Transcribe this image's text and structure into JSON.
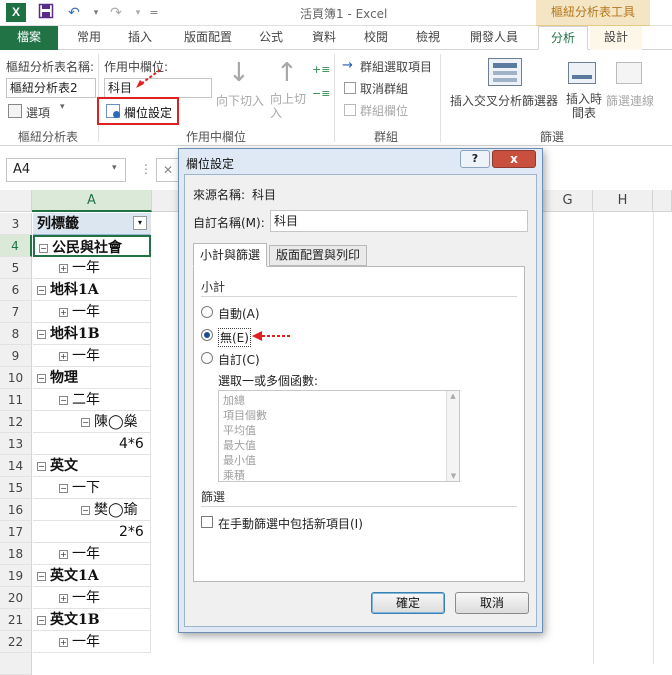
{
  "titlebar": {
    "app_icon_letter": "X",
    "window_title": "活頁簿1 - Excel",
    "context_tool_title": "樞紐分析表工具"
  },
  "tabs": [
    "檔案",
    "常用",
    "插入",
    "版面配置",
    "公式",
    "資料",
    "校閱",
    "檢視",
    "開發人員",
    "分析",
    "設計"
  ],
  "ribbon": {
    "pivot_name_label": "樞紐分析表名稱:",
    "pivot_name_value": "樞紐分析表2",
    "options_label": "選項",
    "group_pivot": "樞紐分析表",
    "active_field_label": "作用中欄位:",
    "active_field_value": "科目",
    "field_settings_label": "欄位設定",
    "drill_down_label": "向下切入",
    "drill_up_label": "向上切入",
    "group_active_field": "作用中欄位",
    "group_selection": "群組選取項目",
    "ungroup": "取消群組",
    "group_field": "群組欄位",
    "group_group": "群組",
    "insert_slicer": "插入交叉分析篩選器",
    "insert_timeline": "插入時間表",
    "filter_connections": "篩選連線",
    "group_filter": "篩選"
  },
  "namebox": {
    "value": "A4"
  },
  "columns": [
    "A",
    "G",
    "H"
  ],
  "rows": [
    {
      "num": "3",
      "text": "列標籤",
      "style": "header"
    },
    {
      "num": "4",
      "text": "公民與社會",
      "style": "bold",
      "expander": "minus",
      "indent": 0
    },
    {
      "num": "5",
      "text": "一年",
      "style": "normal",
      "expander": "plus",
      "indent": 1
    },
    {
      "num": "6",
      "text": "地科1A",
      "style": "bold",
      "expander": "minus",
      "indent": 0
    },
    {
      "num": "7",
      "text": "一年",
      "style": "normal",
      "expander": "plus",
      "indent": 1
    },
    {
      "num": "8",
      "text": "地科1B",
      "style": "bold",
      "expander": "minus",
      "indent": 0
    },
    {
      "num": "9",
      "text": "一年",
      "style": "normal",
      "expander": "plus",
      "indent": 1
    },
    {
      "num": "10",
      "text": "物理",
      "style": "bold",
      "expander": "minus",
      "indent": 0
    },
    {
      "num": "11",
      "text": "二年",
      "style": "normal",
      "expander": "minus",
      "indent": 1
    },
    {
      "num": "12",
      "text": "陳◯燊",
      "style": "normal",
      "expander": "minus",
      "indent": 2
    },
    {
      "num": "13",
      "text": "4*6",
      "style": "normal",
      "expander": "",
      "indent": 3
    },
    {
      "num": "14",
      "text": "英文",
      "style": "bold",
      "expander": "minus",
      "indent": 0
    },
    {
      "num": "15",
      "text": "一下",
      "style": "normal",
      "expander": "minus",
      "indent": 1
    },
    {
      "num": "16",
      "text": "樊◯瑜",
      "style": "normal",
      "expander": "minus",
      "indent": 2
    },
    {
      "num": "17",
      "text": "2*6",
      "style": "normal",
      "expander": "",
      "indent": 3
    },
    {
      "num": "18",
      "text": "一年",
      "style": "normal",
      "expander": "plus",
      "indent": 1
    },
    {
      "num": "19",
      "text": "英文1A",
      "style": "bold",
      "expander": "minus",
      "indent": 0
    },
    {
      "num": "20",
      "text": "一年",
      "style": "normal",
      "expander": "plus",
      "indent": 1
    },
    {
      "num": "21",
      "text": "英文1B",
      "style": "bold",
      "expander": "minus",
      "indent": 0
    },
    {
      "num": "22",
      "text": "一年",
      "style": "normal",
      "expander": "plus",
      "indent": 1
    }
  ],
  "dialog": {
    "title": "欄位設定",
    "source_name_label": "來源名稱:",
    "source_name_value": "科目",
    "custom_name_label": "自訂名稱(M):",
    "custom_name_value": "科目",
    "tab_subtotals": "小計與篩選",
    "tab_layout": "版面配置與列印",
    "subtotal_section": "小計",
    "radio_auto": "自動(A)",
    "radio_none": "無(E)",
    "radio_custom": "自訂(C)",
    "selected_radio": "none",
    "function_prompt": "選取一或多個函數:",
    "functions": [
      "加總",
      "項目個數",
      "平均值",
      "最大值",
      "最小值",
      "乘積"
    ],
    "filter_section": "篩選",
    "checkbox_label": "在手動篩選中包括新項目(I)",
    "ok": "確定",
    "cancel": "取消",
    "help_btn": "?",
    "close_btn": "x"
  },
  "colors": {
    "excel_green": "#217346",
    "highlight_red": "#e02020",
    "dialog_frame": "#dfe9f5"
  }
}
